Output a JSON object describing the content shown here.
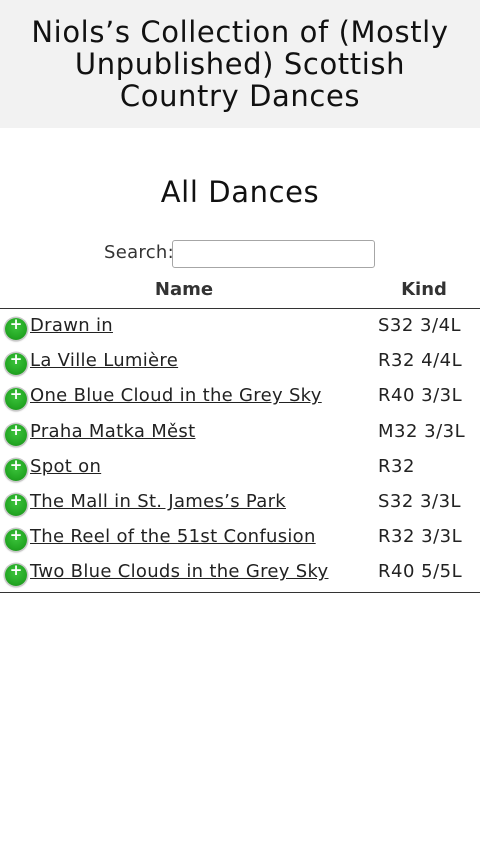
{
  "header": {
    "site_title": "Niols’s Collection of (Mostly Unpublished) Scottish Country Dances"
  },
  "page": {
    "title": "All Dances"
  },
  "search": {
    "label": "Search:",
    "value": "",
    "placeholder": ""
  },
  "table": {
    "headers": {
      "name": "Name",
      "kind": "Kind"
    },
    "rows": [
      {
        "icon": "expand-plus-icon",
        "name": "Drawn in",
        "kind": "S32 3/4L"
      },
      {
        "icon": "expand-plus-icon",
        "name": "La Ville Lumière",
        "kind": "R32 4/4L"
      },
      {
        "icon": "expand-plus-icon",
        "name": "One Blue Cloud in the Grey Sky",
        "kind": "R40 3/3L"
      },
      {
        "icon": "expand-plus-icon",
        "name": "Praha Matka Měst",
        "kind": "M32 3/3L"
      },
      {
        "icon": "expand-plus-icon",
        "name": "Spot on",
        "kind": "R32"
      },
      {
        "icon": "expand-plus-icon",
        "name": "The Mall in St. James’s Park",
        "kind": "S32 3/3L"
      },
      {
        "icon": "expand-plus-icon",
        "name": "The Reel of the 51st Confusion",
        "kind": "R32 3/3L"
      },
      {
        "icon": "expand-plus-icon",
        "name": "Two Blue Clouds in the Grey Sky",
        "kind": "R40 5/5L"
      }
    ]
  },
  "colors": {
    "header_bg": "#f2f2f2",
    "expand_icon": "#24a824",
    "text": "#222222"
  }
}
